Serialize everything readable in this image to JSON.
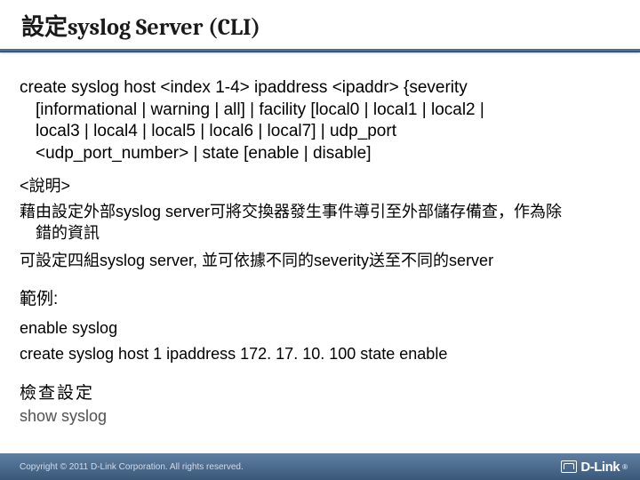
{
  "title_zh": "設定",
  "title_en": "syslog Server (CLI)",
  "command": {
    "line1": "create syslog host <index 1-4> ipaddress <ipaddr> {severity",
    "line2": "[informational | warning | all] | facility [local0 | local1 | local2 |",
    "line3": "local3 | local4 | local5 | local6 | local7] | udp_port",
    "line4": "<udp_port_number> | state [enable | disable]"
  },
  "explain_label": "<說明>",
  "desc1_a": "藉由設定外部syslog server可將交換器發生事件導引至外部儲存備查，作為除",
  "desc1_b": "錯的資訊",
  "desc2": "可設定四組syslog server, 並可依據不同的severity送至不同的server",
  "example_label": "範例:",
  "example1": "enable syslog",
  "example2": "create syslog host 1 ipaddress 172. 17. 10. 100 state enable",
  "check_label": "檢查設定",
  "check_cmd": "show syslog",
  "footer_left": "Copyright © 2011 D-Link Corporation. All rights reserved.",
  "footer_logo": "D-Link"
}
